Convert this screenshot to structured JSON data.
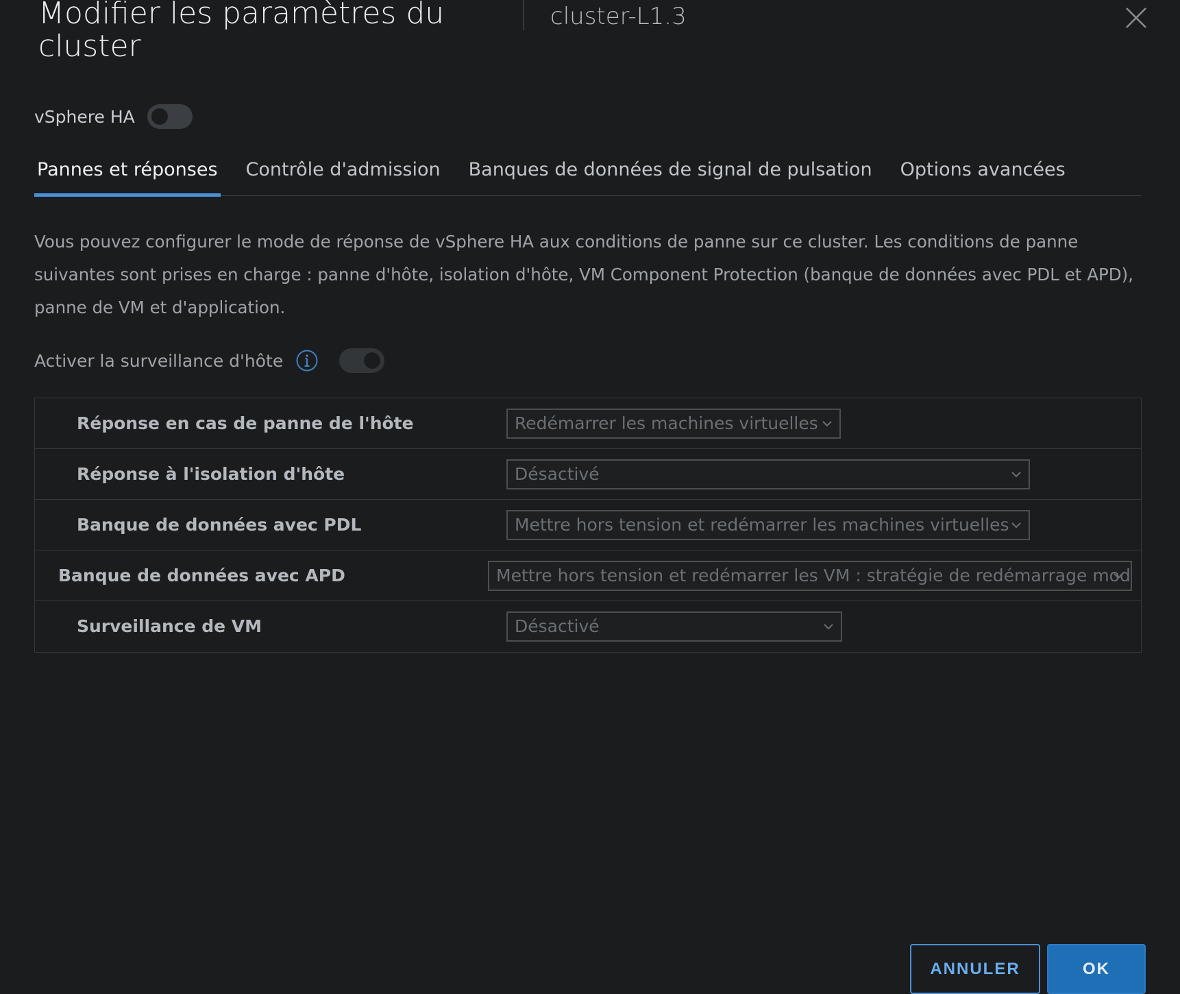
{
  "header": {
    "title": "Modifier les paramètres du cluster",
    "subtitle": "cluster-L1.3"
  },
  "ha": {
    "label": "vSphere HA",
    "enabled": false
  },
  "tabs": [
    {
      "label": "Pannes et réponses",
      "active": true
    },
    {
      "label": "Contrôle d'admission",
      "active": false
    },
    {
      "label": "Banques de données de signal de pulsation",
      "active": false
    },
    {
      "label": "Options avancées",
      "active": false
    }
  ],
  "description": "Vous pouvez configurer le mode de réponse de vSphere HA aux conditions de panne sur ce cluster. Les conditions de panne suivantes sont prises en charge : panne d'hôte, isolation d'hôte, VM Component Protection (banque de données avec PDL et APD), panne de VM et d'application.",
  "host_monitoring": {
    "label": "Activer la surveillance d'hôte",
    "enabled": true
  },
  "settings": [
    {
      "label": "Réponse en cas de panne de l'hôte",
      "value": "Redémarrer les machines virtuelles"
    },
    {
      "label": "Réponse à l'isolation d'hôte",
      "value": "Désactivé"
    },
    {
      "label": "Banque de données avec PDL",
      "value": "Mettre hors tension et redémarrer les machines virtuelles"
    },
    {
      "label": "Banque de données avec APD",
      "value": "Mettre hors tension et redémarrer les VM : stratégie de redémarrage modérée"
    },
    {
      "label": "Surveillance de VM",
      "value": "Désactivé"
    }
  ],
  "footer": {
    "cancel_label": "ANNULER",
    "ok_label": "OK"
  },
  "colors": {
    "background": "#1b1c1e",
    "accent": "#4a90d9",
    "primary_button": "#1e6fb5"
  }
}
